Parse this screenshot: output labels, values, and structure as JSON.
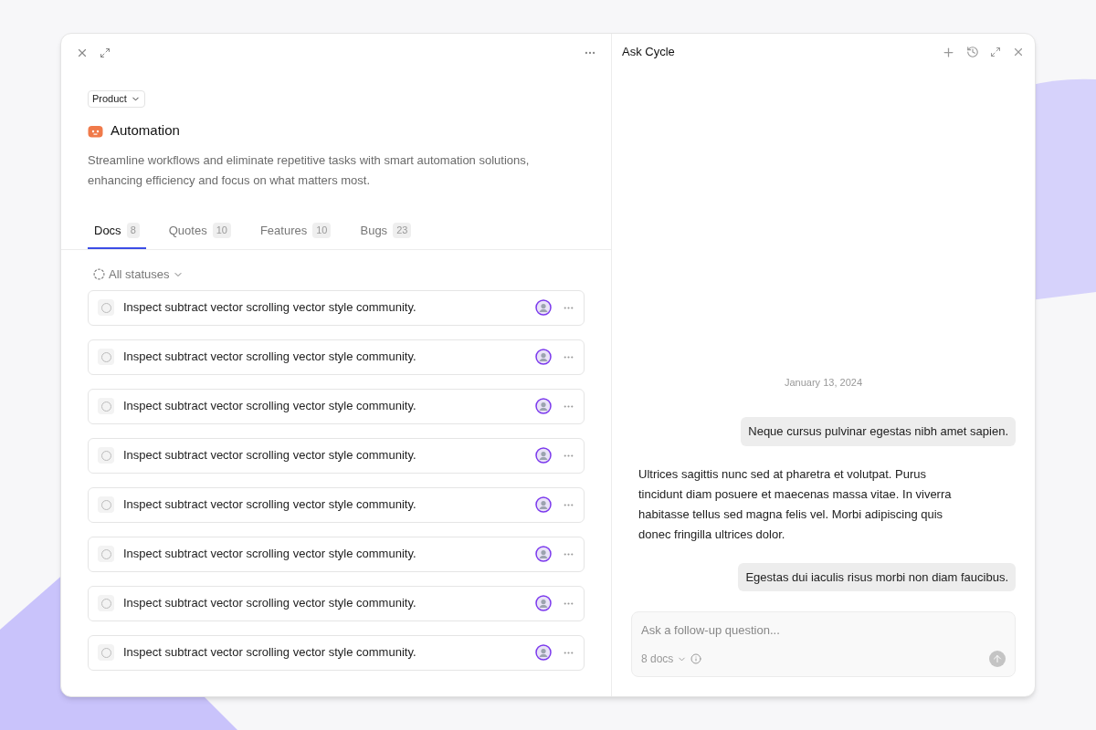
{
  "left_panel": {
    "category": "Product",
    "title": "Automation",
    "description": "Streamline workflows and eliminate repetitive tasks with smart automation solutions, enhancing efficiency and focus on what matters most.",
    "tabs": [
      {
        "label": "Docs",
        "count": "8",
        "selected": true
      },
      {
        "label": "Quotes",
        "count": "10",
        "selected": false
      },
      {
        "label": "Features",
        "count": "10",
        "selected": false
      },
      {
        "label": "Bugs",
        "count": "23",
        "selected": false
      }
    ],
    "filter": "All statuses",
    "docs": [
      {
        "title": "Inspect subtract vector scrolling vector style community."
      },
      {
        "title": "Inspect subtract vector scrolling vector style community."
      },
      {
        "title": "Inspect subtract vector scrolling vector style community."
      },
      {
        "title": "Inspect subtract vector scrolling vector style community."
      },
      {
        "title": "Inspect subtract vector scrolling vector style community."
      },
      {
        "title": "Inspect subtract vector scrolling vector style community."
      },
      {
        "title": "Inspect subtract vector scrolling vector style community."
      },
      {
        "title": "Inspect subtract vector scrolling vector style community."
      }
    ]
  },
  "chat_panel": {
    "title": "Ask Cycle",
    "date": "January 13, 2024",
    "messages": [
      {
        "kind": "user",
        "text": "Neque cursus pulvinar egestas nibh amet sapien."
      },
      {
        "kind": "assistant",
        "text": "Ultrices sagittis nunc sed at pharetra et volutpat. Purus tincidunt diam posuere et maecenas massa vitae. In viverra habitasse tellus sed magna felis vel. Morbi adipiscing quis donec fringilla ultrices dolor."
      },
      {
        "kind": "user",
        "text": "Egestas dui iaculis risus morbi non diam faucibus."
      }
    ],
    "input": {
      "placeholder": "Ask a follow-up question...",
      "docs_selector": "8 docs"
    }
  }
}
